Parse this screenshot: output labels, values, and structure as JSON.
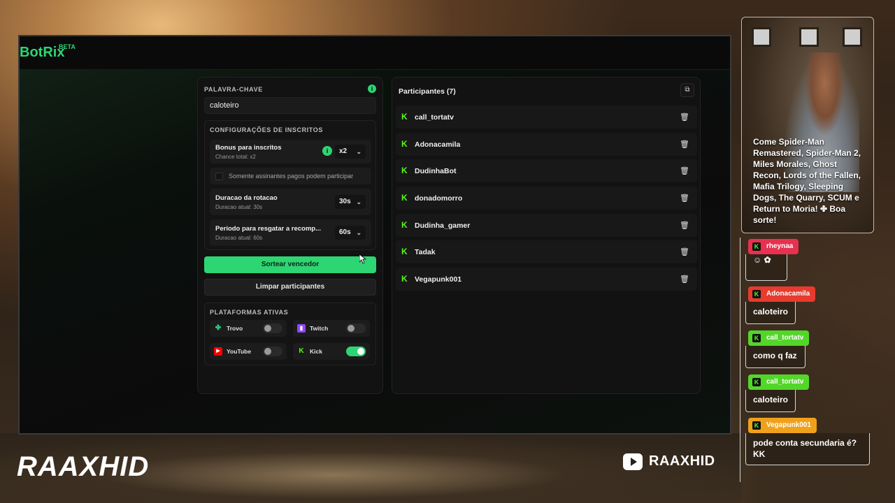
{
  "app": {
    "logo": "BotRix",
    "logo_badge": "BETA"
  },
  "keyword": {
    "title": "PALAVRA-CHAVE",
    "info": "i",
    "value": "caloteiro"
  },
  "subscribers": {
    "title": "CONFIGURAÇÕES DE INSCRITOS",
    "bonus_label": "Bonus para inscritos",
    "bonus_sub": "Chance total: x2",
    "bonus_value": "x2",
    "paid_only_label": "Somente assinantes pagos podem participar",
    "duration_label": "Duracao da rotacao",
    "duration_sub": "Duracao atual: 30s",
    "duration_value": "30s",
    "redeem_label": "Periodo para resgatar a recomp...",
    "redeem_sub": "Duracao atual: 60s",
    "redeem_value": "60s"
  },
  "actions": {
    "draw_winner": "Sortear vencedor",
    "clear_participants": "Limpar participantes"
  },
  "platforms": {
    "title": "PLATAFORMAS ATIVAS",
    "items": [
      {
        "name": "Trovo",
        "enabled": false,
        "color": "#1fd889",
        "icon": "trovo-icon"
      },
      {
        "name": "Twitch",
        "enabled": false,
        "color": "#9146ff",
        "icon": "twitch-icon"
      },
      {
        "name": "YouTube",
        "enabled": false,
        "color": "#ff0000",
        "icon": "youtube-icon"
      },
      {
        "name": "Kick",
        "enabled": true,
        "color": "#53fc18",
        "icon": "kick-icon"
      }
    ]
  },
  "participants": {
    "title": "Participantes (7)",
    "list": [
      "call_tortatv",
      "Adonacamila",
      "DudinhaBot",
      "donadomorro",
      "Dudinha_gamer",
      "Tadak",
      "Vegapunk001"
    ]
  },
  "branding": {
    "left": "RAAXHID",
    "right": "RAAXHID"
  },
  "cam_overlay_text": "Come Spider-Man Remastered, Spider-Man 2, Miles Morales, Ghost Recon, Lords of the Fallen, Mafia Trilogy, Sleeping Dogs, The Quarry, SCUM e Return to Moria! ✤ Boa sorte!",
  "chat": [
    {
      "user": "rheynaa",
      "message": "",
      "color": "#e8304f"
    },
    {
      "user": "Adonacamila",
      "message": "caloteiro",
      "color": "#e63b2e"
    },
    {
      "user": "call_tortatv",
      "message": "como q faz",
      "color": "#53d62a"
    },
    {
      "user": "call_tortatv",
      "message": "caloteiro",
      "color": "#53d62a"
    },
    {
      "user": "Vegapunk001",
      "message": "pode conta secundaria é? KK",
      "color": "#f0a11a"
    }
  ],
  "colors": {
    "accent": "#2ed573",
    "kick": "#53fc18",
    "panel": "#121212"
  }
}
